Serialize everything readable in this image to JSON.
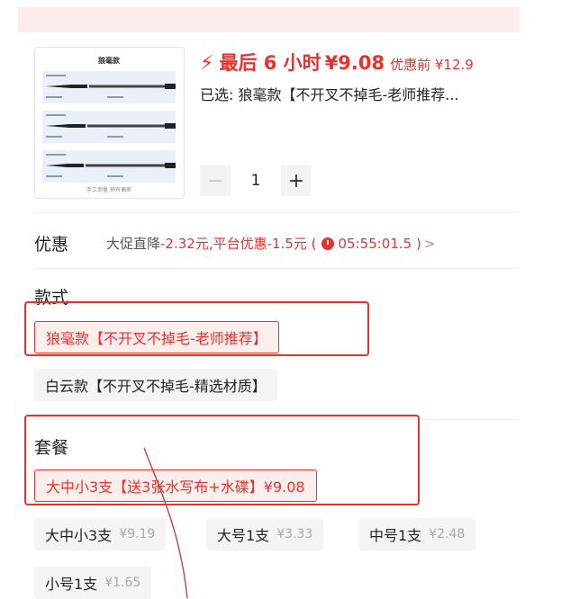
{
  "product": {
    "thumbnail_title": "狼毫款",
    "thumbnail_footer": "手工测量 稍有偏差",
    "flash_label": "最后 6 小时",
    "price": "¥9.08",
    "original_price": "优惠前 ¥12.9",
    "selected_text": "已选: 狼毫款【不开叉不掉毛-老师推荐..."
  },
  "quantity": {
    "minus": "−",
    "value": "1",
    "plus": "+"
  },
  "promo": {
    "label": "优惠",
    "prefix": "大促直降",
    "discount1": "-2.32元,",
    "platform_prefix": "平台优惠",
    "discount2": "-1.5元 (",
    "countdown": "05:55:01.5 )",
    "chevron": ">"
  },
  "style_section": {
    "title": "款式",
    "options": [
      {
        "label": "狼毫款【不开叉不掉毛-老师推荐】"
      },
      {
        "label": "白云款【不开叉不掉毛-精选材质】"
      }
    ]
  },
  "package_section": {
    "title": "套餐",
    "selected": {
      "label": "大中小3支【送3张水写布+水碟】¥9.08"
    },
    "options": [
      {
        "label": "大中小3支",
        "price": "¥9.19"
      },
      {
        "label": "大号1支",
        "price": "¥3.33"
      },
      {
        "label": "中号1支",
        "price": "¥2.48"
      },
      {
        "label": "小号1支",
        "price": "¥1.65"
      }
    ]
  },
  "colors": {
    "accent": "#e8322d",
    "chip_bg": "#f4f4f4",
    "muted": "#aaaaaa"
  }
}
